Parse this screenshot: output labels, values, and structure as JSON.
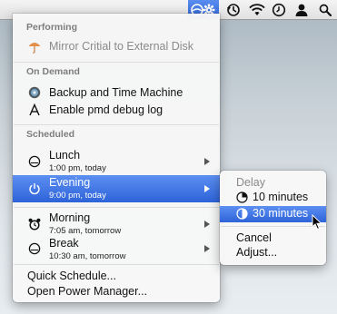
{
  "menubar": {
    "icons": [
      "power-schedule-icon",
      "time-machine-icon",
      "wifi-icon",
      "clock-icon",
      "user-icon",
      "spotlight-icon"
    ]
  },
  "menu": {
    "sections": {
      "performing": "Performing",
      "on_demand": "On Demand",
      "scheduled": "Scheduled"
    },
    "performing_items": [
      {
        "label": "Mirror Critial to External Disk",
        "icon": "umbrella-icon"
      }
    ],
    "on_demand_items": [
      {
        "label": "Backup and Time Machine",
        "icon": "backup-disk-icon"
      },
      {
        "label": "Enable pmd debug log",
        "icon": "app-store-icon"
      }
    ],
    "scheduled_items": [
      {
        "label": "Lunch",
        "time": "1:00 pm, today",
        "icon": "empty-circle-icon"
      },
      {
        "label": "Evening",
        "time": "9:00 pm, today",
        "icon": "power-icon",
        "selected": true
      },
      {
        "label": "Morning",
        "time": "7:05 am, tomorrow",
        "icon": "alarm-clock-icon"
      },
      {
        "label": "Break",
        "time": "10:30 am, tomorrow",
        "icon": "empty-circle-icon"
      }
    ],
    "footer": {
      "quick_schedule": "Quick Schedule...",
      "open_power_manager": "Open Power Manager..."
    }
  },
  "submenu": {
    "header": "Delay",
    "items": [
      {
        "label": "10 minutes",
        "icon": "quarter-clock-icon"
      },
      {
        "label": "30 minutes",
        "icon": "half-clock-icon",
        "selected": true
      }
    ],
    "cancel": "Cancel",
    "adjust": "Adjust..."
  },
  "colors": {
    "selection": "#3a6fe0",
    "section_header": "#7d7d7d"
  }
}
